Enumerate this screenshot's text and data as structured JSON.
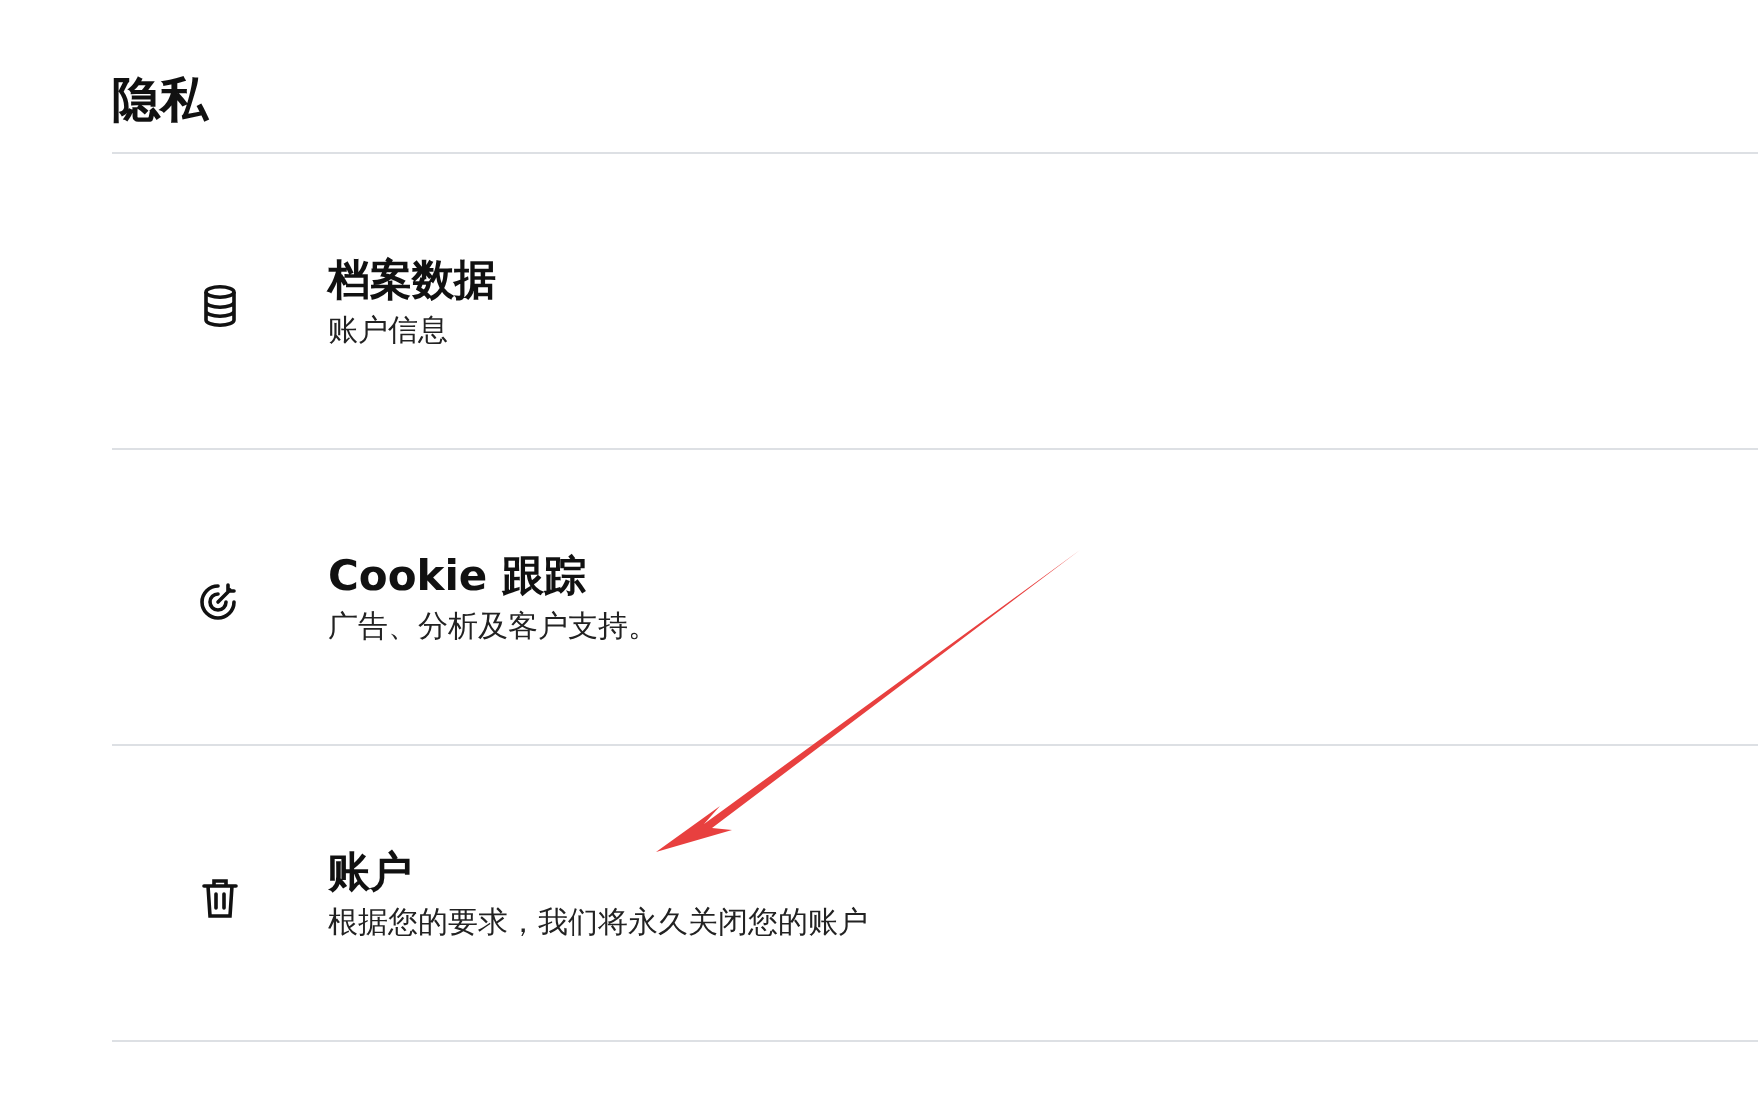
{
  "heading": "隐私",
  "items": [
    {
      "kind": "database",
      "title": "档案数据",
      "subtitle": "账户信息"
    },
    {
      "kind": "target",
      "title": "Cookie 跟踪",
      "subtitle": "广告、分析及客户支持。"
    },
    {
      "kind": "trash",
      "title": "账户",
      "subtitle": "根据您的要求，我们将永久关闭您的账户"
    }
  ]
}
